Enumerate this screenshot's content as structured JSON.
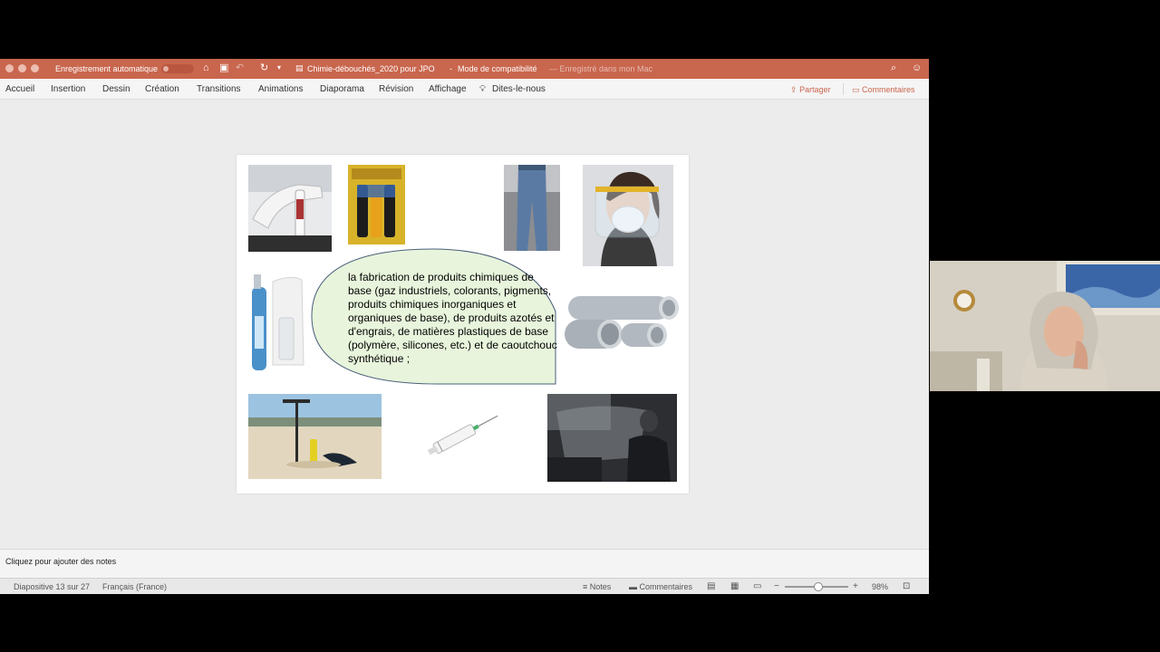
{
  "titlebar": {
    "autosave_label": "Enregistrement automatique",
    "document_title": "Chimie-débouchés_2020 pour JPO",
    "compat_mode": "Mode de compatibilité",
    "saved_location": "— Enregistré dans mon Mac"
  },
  "ribbon": {
    "tabs": [
      "Accueil",
      "Insertion",
      "Dessin",
      "Création",
      "Transitions",
      "Animations",
      "Diaporama",
      "Révision",
      "Affichage"
    ],
    "tell_me": "Dites-le-nous",
    "share": "Partager",
    "comments": "Commentaires"
  },
  "slide": {
    "bubble_text": "la fabrication de produits chimiques de base (gaz industriels, colorants, pigments, produits chimiques inorganiques et organiques de base), de produits azotés et d'engrais, de matières plastiques de base (polymère, silicones, etc.) et de caoutchouc synthétique ;",
    "bubble_color": "#e8f5dc"
  },
  "notes": {
    "placeholder": "Cliquez pour ajouter des notes"
  },
  "statusbar": {
    "slide_counter": "Diapositive 13 sur 27",
    "language": "Français (France)",
    "notes_button": "Notes",
    "comments_button": "Commentaires",
    "zoom": "98%"
  },
  "colors": {
    "accent": "#c9664e"
  }
}
